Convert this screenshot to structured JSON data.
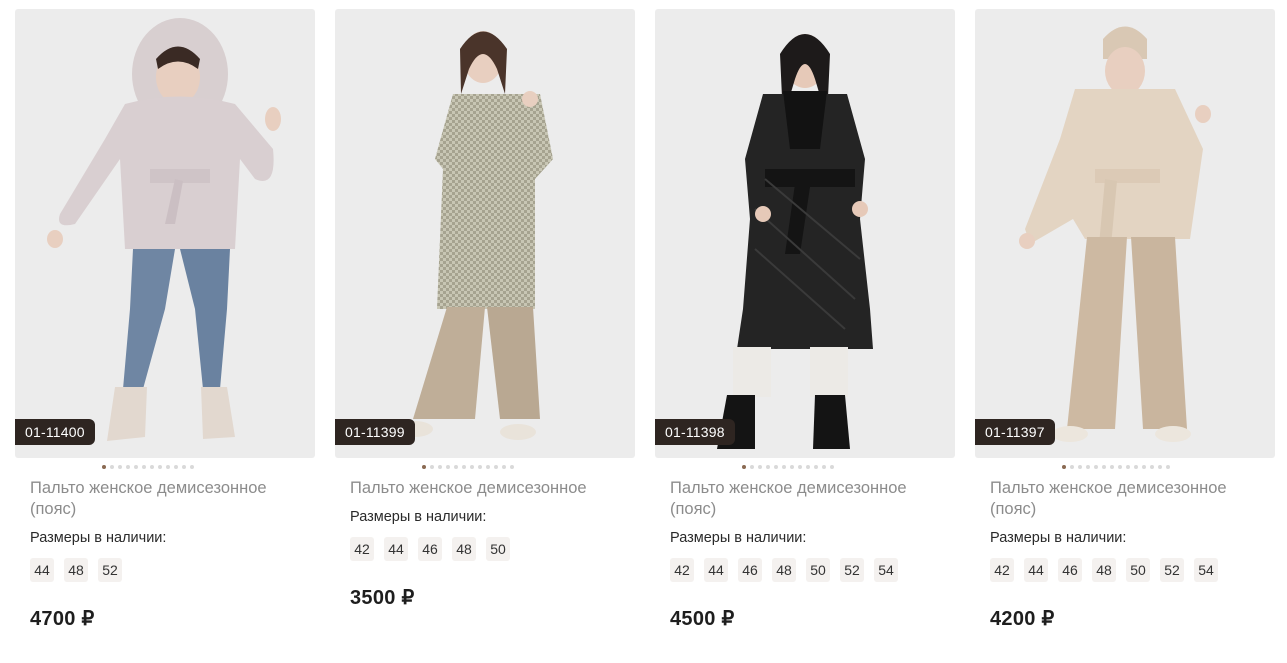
{
  "products": [
    {
      "sku": "01-11400",
      "name": "Пальто женское демисезонное (пояс)",
      "sizes_label": "Размеры в наличии:",
      "sizes": [
        "44",
        "48",
        "52"
      ],
      "price": "4700 ₽",
      "dots_total": 12,
      "dots_active": 0,
      "image": "photo of model in lilac hooded coat with belt"
    },
    {
      "sku": "01-11399",
      "name": "Пальто женское демисезонное",
      "sizes_label": "Размеры в наличии:",
      "sizes": [
        "42",
        "44",
        "46",
        "48",
        "50"
      ],
      "price": "3500 ₽",
      "dots_total": 12,
      "dots_active": 0,
      "image": "photo of model in houndstooth coat"
    },
    {
      "sku": "01-11398",
      "name": "Пальто женское демисезонное (пояс)",
      "sizes_label": "Размеры в наличии:",
      "sizes": [
        "42",
        "44",
        "46",
        "48",
        "50",
        "52",
        "54"
      ],
      "price": "4500 ₽",
      "dots_total": 12,
      "dots_active": 0,
      "image": "photo of model in black quilted coat with fur collar"
    },
    {
      "sku": "01-11397",
      "name": "Пальто женское демисезонное (пояс)",
      "sizes_label": "Размеры в наличии:",
      "sizes": [
        "42",
        "44",
        "46",
        "48",
        "50",
        "52",
        "54"
      ],
      "price": "4200 ₽",
      "dots_total": 14,
      "dots_active": 0,
      "image": "photo of model in beige teddy jacket with belt"
    }
  ],
  "colors": {
    "sku_badge": "#2e2521",
    "photo_bg": "#ececec",
    "size_chip": "#f4f1ef",
    "name_text": "#8c8c8c",
    "dot_active": "#8a6a52"
  }
}
